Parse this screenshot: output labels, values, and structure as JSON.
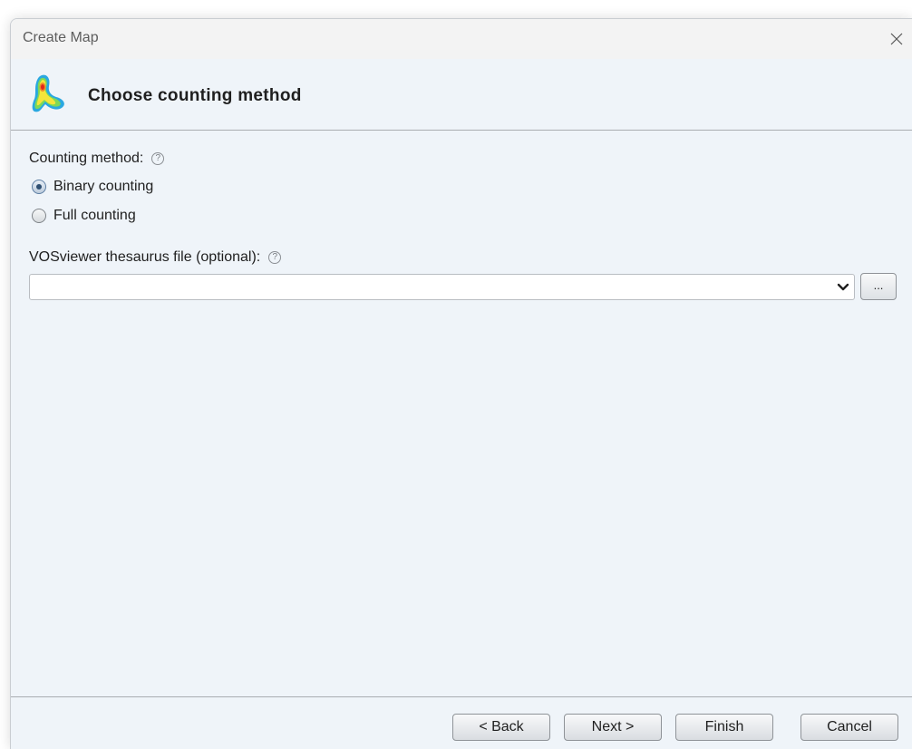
{
  "window": {
    "title": "Create Map",
    "close_icon": "close-icon"
  },
  "header": {
    "heading": "Choose counting method",
    "logo_icon": "vosviewer-logo"
  },
  "counting": {
    "label": "Counting method:",
    "help_glyph": "?",
    "options": [
      {
        "label": "Binary counting",
        "checked": true
      },
      {
        "label": "Full counting",
        "checked": false
      }
    ]
  },
  "thesaurus": {
    "label": "VOSviewer thesaurus file (optional):",
    "help_glyph": "?",
    "value": "",
    "browse_label": "..."
  },
  "buttons": {
    "back": "< Back",
    "next": "Next >",
    "finish": "Finish",
    "cancel": "Cancel"
  },
  "colors": {
    "background": "#eff4f9",
    "titlebar": "#f3f3f3",
    "radio_accent": "#2e4f72"
  }
}
